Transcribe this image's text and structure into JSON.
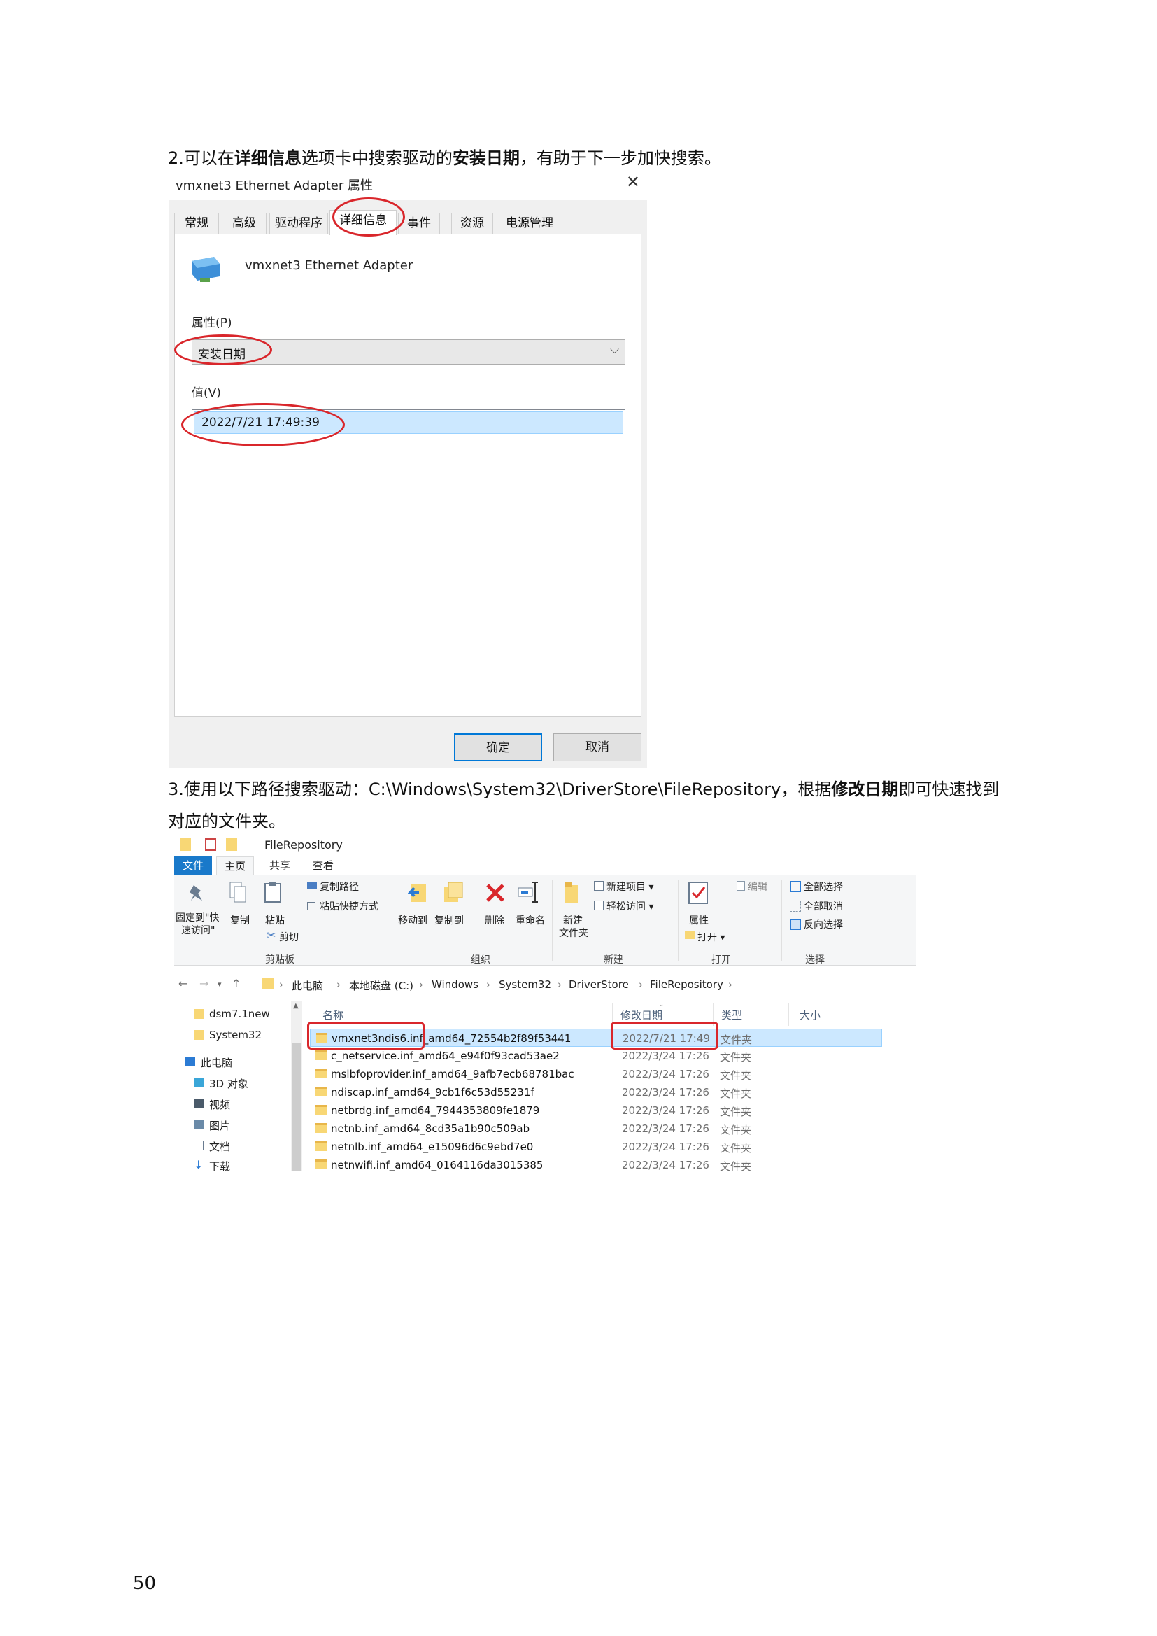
{
  "doc": {
    "para2": {
      "t1": "2.可以在",
      "b1": "详细信息",
      "t2": "选项卡中搜索驱动的",
      "b2": "安装日期",
      "t3": "，有助于下一步加快搜索。"
    },
    "para3": {
      "line1_t1": "3.使用以下路径搜索驱动：C:\\Windows\\System32\\DriverStore\\FileRepository，根据",
      "line1_b1": "修改日期",
      "line1_t2": "即可快速找到",
      "line2": "对应的文件夹。"
    },
    "page_number": "50"
  },
  "dialog": {
    "title": "vmxnet3 Ethernet Adapter 属性",
    "close": "✕",
    "tabs": [
      "常规",
      "高级",
      "驱动程序",
      "详细信息",
      "事件",
      "资源",
      "电源管理"
    ],
    "device_name": "vmxnet3 Ethernet Adapter",
    "property_label": "属性(P)",
    "property_value": "安装日期",
    "value_label": "值(V)",
    "value": "2022/7/21 17:49:39",
    "ok": "确定",
    "cancel": "取消",
    "highlight_color": "#d9262b"
  },
  "explorer": {
    "title": "FileRepository",
    "ribbon_tabs": [
      "文件",
      "主页",
      "共享",
      "查看"
    ],
    "ribbon": {
      "pin_l1": "固定到\"快",
      "pin_l2": "速访问\"",
      "copy": "复制",
      "paste": "粘贴",
      "copy_path": "复制路径",
      "paste_shortcut": "粘贴快捷方式",
      "cut": "剪切",
      "group_clipboard": "剪贴板",
      "move_to": "移动到",
      "copy_to": "复制到",
      "delete": "删除",
      "rename": "重命名",
      "group_organize": "组织",
      "new_item": "新建项目 ▾",
      "easy_access": "轻松访问 ▾",
      "new_folder_l1": "新建",
      "new_folder_l2": "文件夹",
      "group_new": "新建",
      "properties": "属性",
      "open": "打开 ▾",
      "edit": "编辑",
      "group_open": "打开",
      "select_all": "全部选择",
      "select_none": "全部取消",
      "invert": "反向选择",
      "group_select": "选择"
    },
    "breadcrumb": [
      "此电脑",
      "本地磁盘 (C:)",
      "Windows",
      "System32",
      "DriverStore",
      "FileRepository"
    ],
    "nav_items": [
      "dsm7.1new",
      "System32",
      "此电脑",
      "3D 对象",
      "视频",
      "图片",
      "文档",
      "下载"
    ],
    "columns": [
      "名称",
      "修改日期",
      "类型",
      "大小"
    ],
    "files": [
      {
        "name": "vmxnet3ndis6.inf_amd64_72554b2f89f53441",
        "date": "2022/7/21 17:49",
        "type": "文件夹"
      },
      {
        "name": "c_netservice.inf_amd64_e94f0f93cad53ae2",
        "date": "2022/3/24 17:26",
        "type": "文件夹"
      },
      {
        "name": "mslbfoprovider.inf_amd64_9afb7ecb68781bac",
        "date": "2022/3/24 17:26",
        "type": "文件夹"
      },
      {
        "name": "ndiscap.inf_amd64_9cb1f6c53d55231f",
        "date": "2022/3/24 17:26",
        "type": "文件夹"
      },
      {
        "name": "netbrdg.inf_amd64_7944353809fe1879",
        "date": "2022/3/24 17:26",
        "type": "文件夹"
      },
      {
        "name": "netnb.inf_amd64_8cd35a1b90c509ab",
        "date": "2022/3/24 17:26",
        "type": "文件夹"
      },
      {
        "name": "netnlb.inf_amd64_e15096d6c9ebd7e0",
        "date": "2022/3/24 17:26",
        "type": "文件夹"
      },
      {
        "name": "netnwifi.inf_amd64_0164116da3015385",
        "date": "2022/3/24 17:26",
        "type": "文件夹"
      }
    ]
  }
}
